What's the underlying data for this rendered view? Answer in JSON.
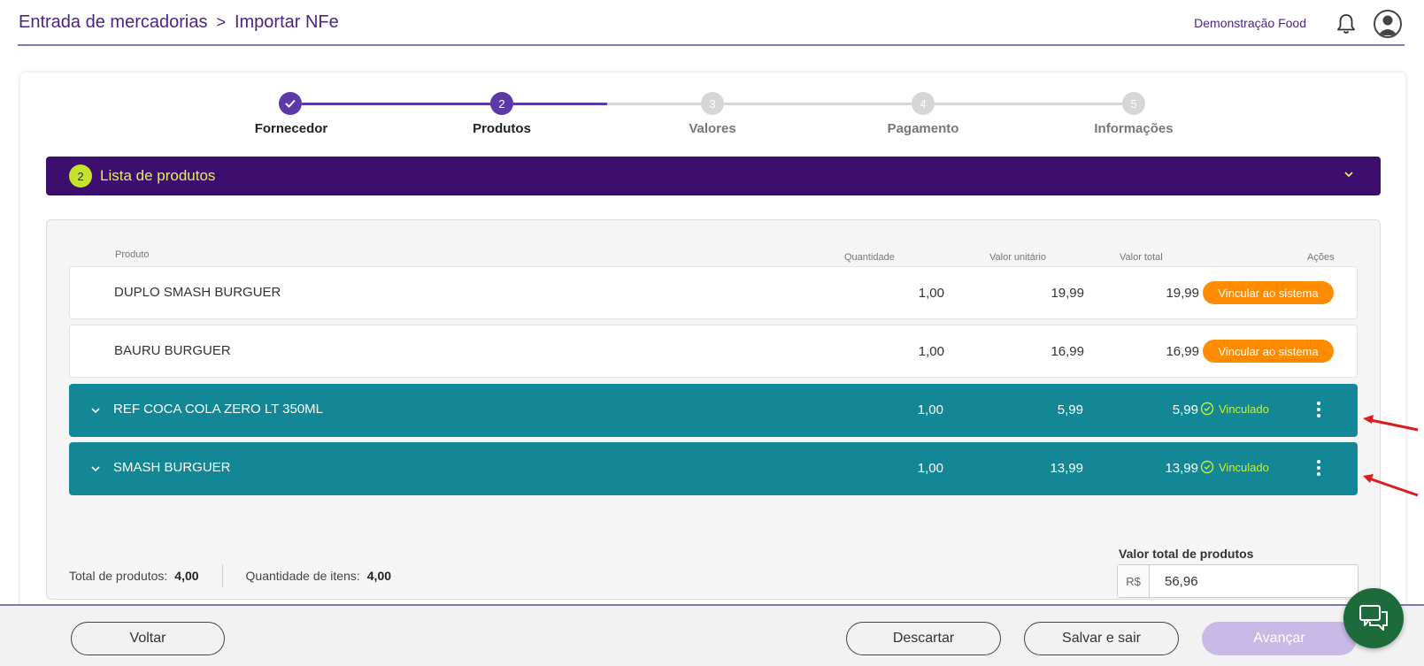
{
  "header": {
    "breadcrumb": [
      "Entrada de mercadorias",
      "Importar NFe"
    ],
    "breadcrumb_sep": ">",
    "company": "Demonstração Food",
    "icons": [
      "bell-icon",
      "avatar-icon"
    ]
  },
  "stepper": {
    "steps": [
      {
        "number": "1",
        "label": "Fornecedor",
        "state": "done"
      },
      {
        "number": "2",
        "label": "Produtos",
        "state": "current"
      },
      {
        "number": "3",
        "label": "Valores",
        "state": "todo"
      },
      {
        "number": "4",
        "label": "Pagamento",
        "state": "todo"
      },
      {
        "number": "5",
        "label": "Informações",
        "state": "todo"
      }
    ],
    "active_color": "#5b3aa8",
    "inactive_color": "#d6d6d6"
  },
  "section": {
    "number": "2",
    "title": "Lista de produtos",
    "bg_color": "#3d0e6e",
    "accent_color": "#c4e32a"
  },
  "table": {
    "columns": {
      "product": "Produto",
      "quantity": "Quantidade",
      "unit_value": "Valor unitário",
      "total_value": "Valor total",
      "actions": "Ações"
    },
    "rows": [
      {
        "name": "DUPLO SMASH BURGUER",
        "quantity": "1,00",
        "unit_value": "19,99",
        "total_value": "19,99",
        "linked": false,
        "action_label": "Vincular ao sistema"
      },
      {
        "name": "BAURU BURGUER",
        "quantity": "1,00",
        "unit_value": "16,99",
        "total_value": "16,99",
        "linked": false,
        "action_label": "Vincular ao sistema"
      },
      {
        "name": "REF COCA COLA ZERO LT 350ML",
        "quantity": "1,00",
        "unit_value": "5,99",
        "total_value": "5,99",
        "linked": true,
        "status_label": "Vinculado"
      },
      {
        "name": "SMASH BURGUER",
        "quantity": "1,00",
        "unit_value": "13,99",
        "total_value": "13,99",
        "linked": true,
        "status_label": "Vinculado"
      }
    ],
    "linked_row_color": "#138796",
    "action_button_color": "#ff8c00",
    "linked_status_color": "#c4f03a"
  },
  "totals": {
    "products_label": "Total de produtos:",
    "products_value": "4,00",
    "items_label": "Quantidade de itens:",
    "items_value": "4,00",
    "total_value_label": "Valor total de produtos",
    "currency_prefix": "R$",
    "total_value": "56,96"
  },
  "footer": {
    "back_label": "Voltar",
    "discard_label": "Descartar",
    "save_exit_label": "Salvar e sair",
    "next_label": "Avançar",
    "next_color": "#c9b9e6",
    "chat_color": "#1d6b3a"
  },
  "annotations": {
    "arrow_color": "#e01b1b"
  }
}
